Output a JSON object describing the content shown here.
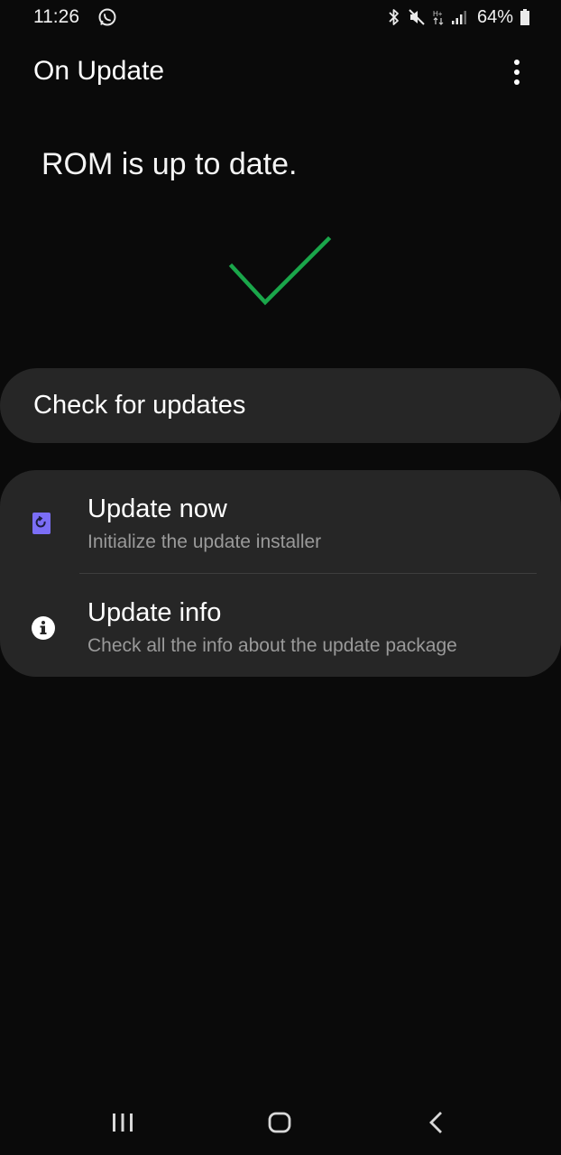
{
  "status_bar": {
    "time": "11:26",
    "battery_percent": "64%",
    "icons": [
      "whatsapp-icon",
      "bluetooth-icon",
      "mute-icon",
      "data-icon",
      "signal-icon",
      "battery-icon"
    ]
  },
  "app_bar": {
    "title": "On Update",
    "menu_icon": "more-vert-icon"
  },
  "status": {
    "message": "ROM is up to date.",
    "icon": "check-icon",
    "accent_color": "#1aa64a"
  },
  "check_updates": {
    "label": "Check for updates"
  },
  "options": [
    {
      "title": "Update now",
      "subtitle": "Initialize the update installer",
      "icon": "update-installer-icon",
      "icon_color": "#7b6ef6"
    },
    {
      "title": "Update info",
      "subtitle": "Check all the info about the update package",
      "icon": "info-icon"
    }
  ],
  "nav_bar": {
    "icons": [
      "recents-icon",
      "home-icon",
      "back-icon"
    ]
  }
}
